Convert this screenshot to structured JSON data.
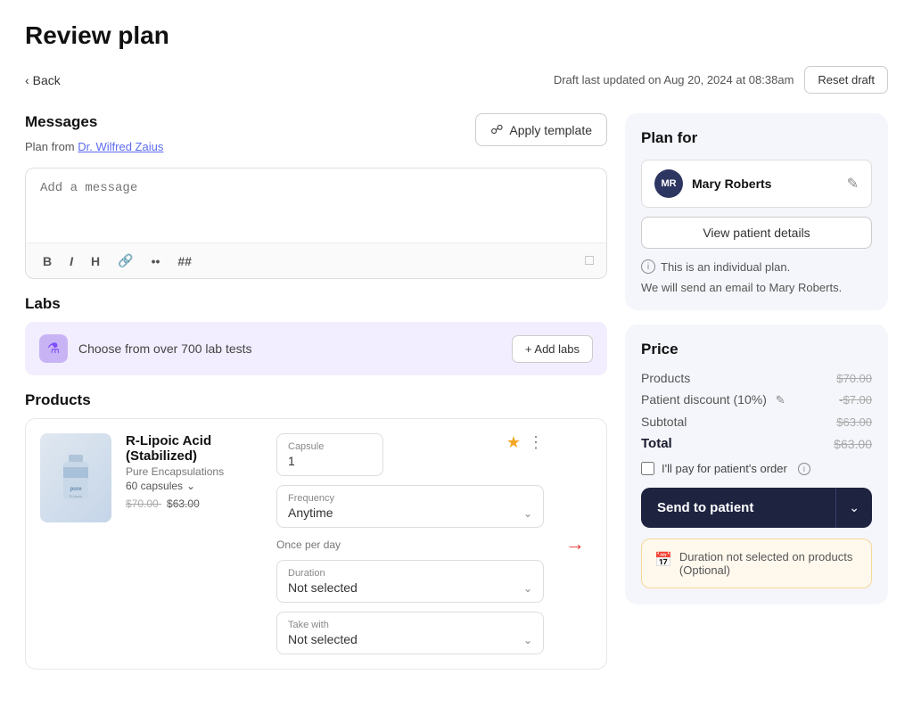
{
  "page": {
    "title": "Review plan"
  },
  "topbar": {
    "back_label": "Back",
    "draft_info": "Draft last updated on Aug 20, 2024 at 08:38am",
    "reset_label": "Reset draft"
  },
  "messages": {
    "section_title": "Messages",
    "plan_from_prefix": "Plan from",
    "plan_from_doctor": "Dr. Wilfred Zaius",
    "message_placeholder": "Add a message",
    "template_btn_label": "Apply template",
    "toolbar": {
      "bold": "B",
      "italic": "I",
      "heading": "H"
    }
  },
  "labs": {
    "section_title": "Labs",
    "lab_text": "Choose from over 700 lab tests",
    "add_labs_label": "+ Add labs"
  },
  "products": {
    "section_title": "Products",
    "items": [
      {
        "name": "R-Lipoic Acid (Stabilized)",
        "brand": "Pure Encapsulations",
        "capsules": "60 capsules",
        "form_label": "Capsule",
        "form_value": "1",
        "frequency_label": "Frequency",
        "frequency_value": "Anytime",
        "frequency_note": "Once per day",
        "duration_label": "Duration",
        "duration_value": "Not selected",
        "take_with_label": "Take with",
        "take_with_value": "Not selected",
        "price_original": "$70.00",
        "price_discounted": "$63.00"
      }
    ]
  },
  "right_panel": {
    "plan_for_title": "Plan for",
    "patient_initials": "MR",
    "patient_name": "Mary Roberts",
    "view_patient_label": "View patient details",
    "individual_plan_note": "This is an individual plan.",
    "email_note": "We will send an email to Mary Roberts.",
    "price_title": "Price",
    "price_rows": [
      {
        "label": "Products",
        "value": "$70.00"
      },
      {
        "label": "Patient discount (10%)",
        "value": "-$7.00"
      },
      {
        "label": "Subtotal",
        "value": "$63.00"
      }
    ],
    "total_label": "Total",
    "total_value": "$63.00",
    "pay_checkbox_label": "I'll pay for patient's order",
    "send_btn_label": "Send to patient",
    "duration_warning": "Duration not selected on products (Optional)"
  }
}
